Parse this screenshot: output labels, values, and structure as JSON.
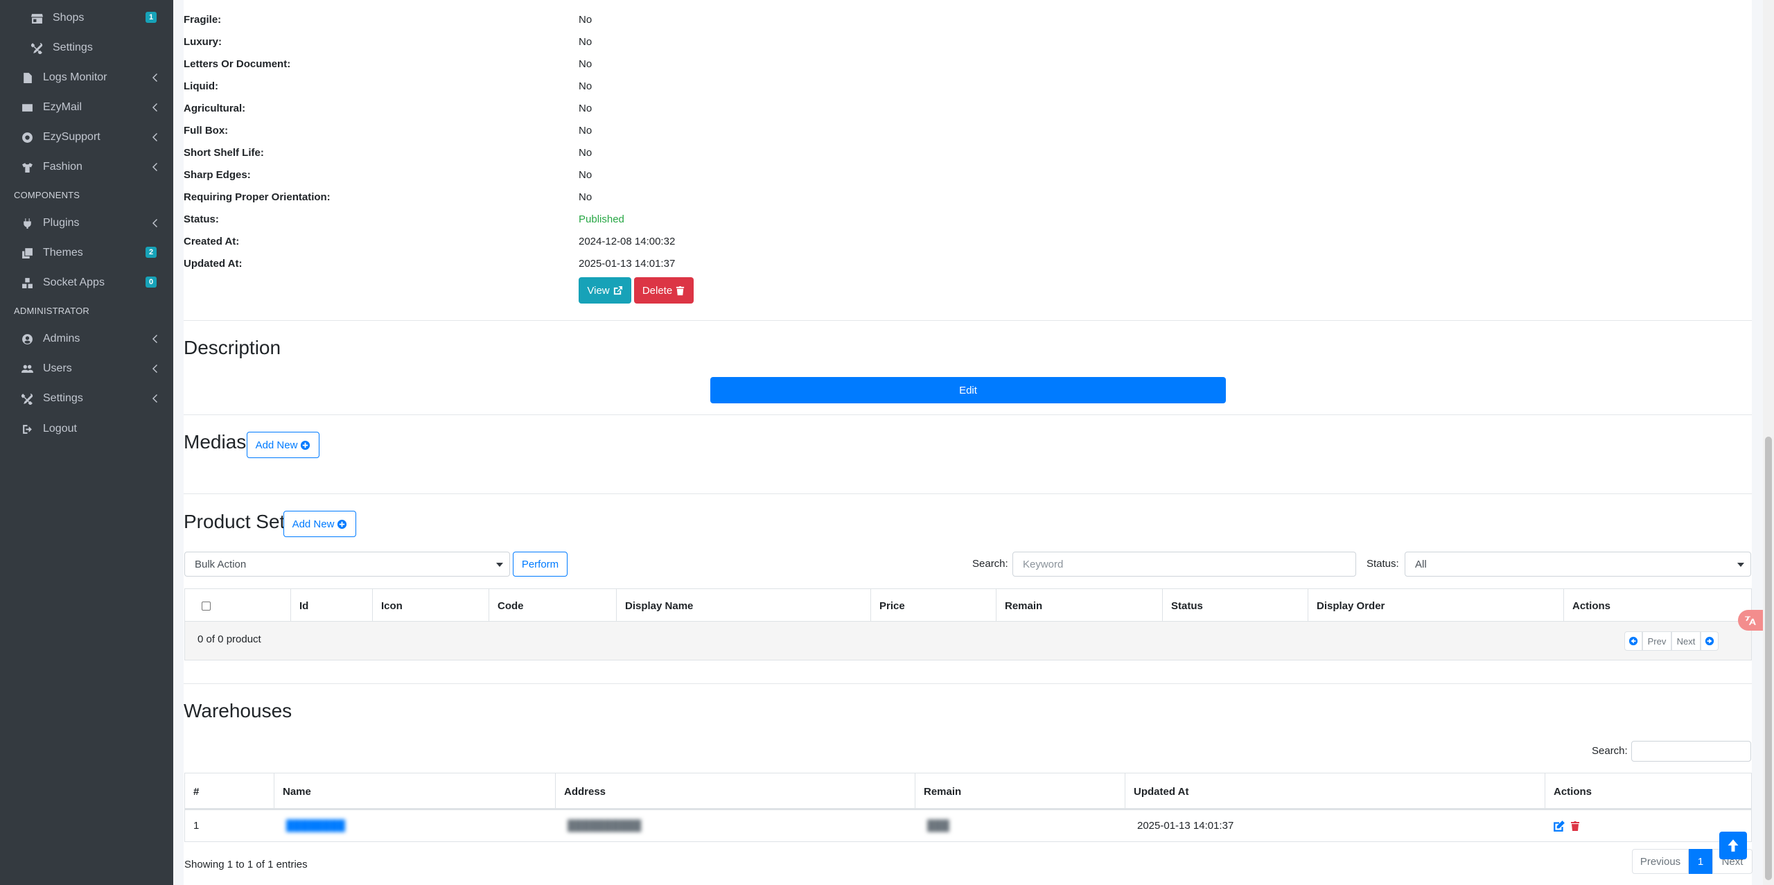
{
  "sidebar": {
    "items": [
      {
        "label": "Shops",
        "icon": "store-icon",
        "badge": "1"
      },
      {
        "label": "Settings",
        "icon": "tools-icon"
      },
      {
        "label": "Logs Monitor",
        "icon": "file-icon"
      },
      {
        "label": "EzyMail",
        "icon": "envelope-icon"
      },
      {
        "label": "EzySupport",
        "icon": "life-ring-icon"
      },
      {
        "label": "Fashion",
        "icon": "tshirt-icon"
      },
      {
        "label": "Plugins",
        "icon": "plug-icon"
      },
      {
        "label": "Themes",
        "icon": "clone-icon",
        "badge": "2"
      },
      {
        "label": "Socket Apps",
        "icon": "cubes-icon",
        "badge": "0"
      },
      {
        "label": "Admins",
        "icon": "user-circle-icon"
      },
      {
        "label": "Users",
        "icon": "users-icon"
      },
      {
        "label": "Settings",
        "icon": "tools-icon"
      },
      {
        "label": "Logout",
        "icon": "sign-out-icon"
      }
    ],
    "headers": {
      "components": "COMPONENTS",
      "administrator": "ADMINISTRATOR"
    }
  },
  "details": {
    "rows": [
      {
        "label": "Fragile:",
        "value": "No"
      },
      {
        "label": "Luxury:",
        "value": "No"
      },
      {
        "label": "Letters Or Document:",
        "value": "No"
      },
      {
        "label": "Liquid:",
        "value": "No"
      },
      {
        "label": "Agricultural:",
        "value": "No"
      },
      {
        "label": "Full Box:",
        "value": "No"
      },
      {
        "label": "Short Shelf Life:",
        "value": "No"
      },
      {
        "label": "Sharp Edges:",
        "value": "No"
      },
      {
        "label": "Requiring Proper Orientation:",
        "value": "No"
      },
      {
        "label": "Status:",
        "value": "Published"
      },
      {
        "label": "Created At:",
        "value": "2024-12-08 14:00:32"
      },
      {
        "label": "Updated At:",
        "value": "2025-01-13 14:01:37"
      }
    ],
    "view_label": "View",
    "delete_label": "Delete"
  },
  "description": {
    "title": "Description",
    "edit_label": "Edit"
  },
  "medias": {
    "title": "Medias",
    "add_label": "Add New"
  },
  "product_set": {
    "title": "Product Set",
    "add_label": "Add New",
    "bulk_action": "Bulk Action",
    "perform_label": "Perform",
    "search_label": "Search:",
    "search_placeholder": "Keyword",
    "status_label": "Status:",
    "status_value": "All",
    "columns": [
      "Id",
      "Icon",
      "Code",
      "Display Name",
      "Price",
      "Remain",
      "Status",
      "Display Order",
      "Actions"
    ],
    "summary": "0 of 0 product",
    "prev_label": "Prev",
    "next_label": "Next"
  },
  "warehouses": {
    "title": "Warehouses",
    "search_label": "Search:",
    "columns": [
      "#",
      "Name",
      "Address",
      "Remain",
      "Updated At",
      "Actions"
    ],
    "rows": [
      {
        "index": "1",
        "name": "████████",
        "address": "██████████",
        "remain": "███",
        "updated_at": "2025-01-13 14:01:37"
      }
    ],
    "info": "Showing 1 to 1 of 1 entries",
    "previous_label": "Previous",
    "page": "1",
    "next_label": "Next"
  }
}
